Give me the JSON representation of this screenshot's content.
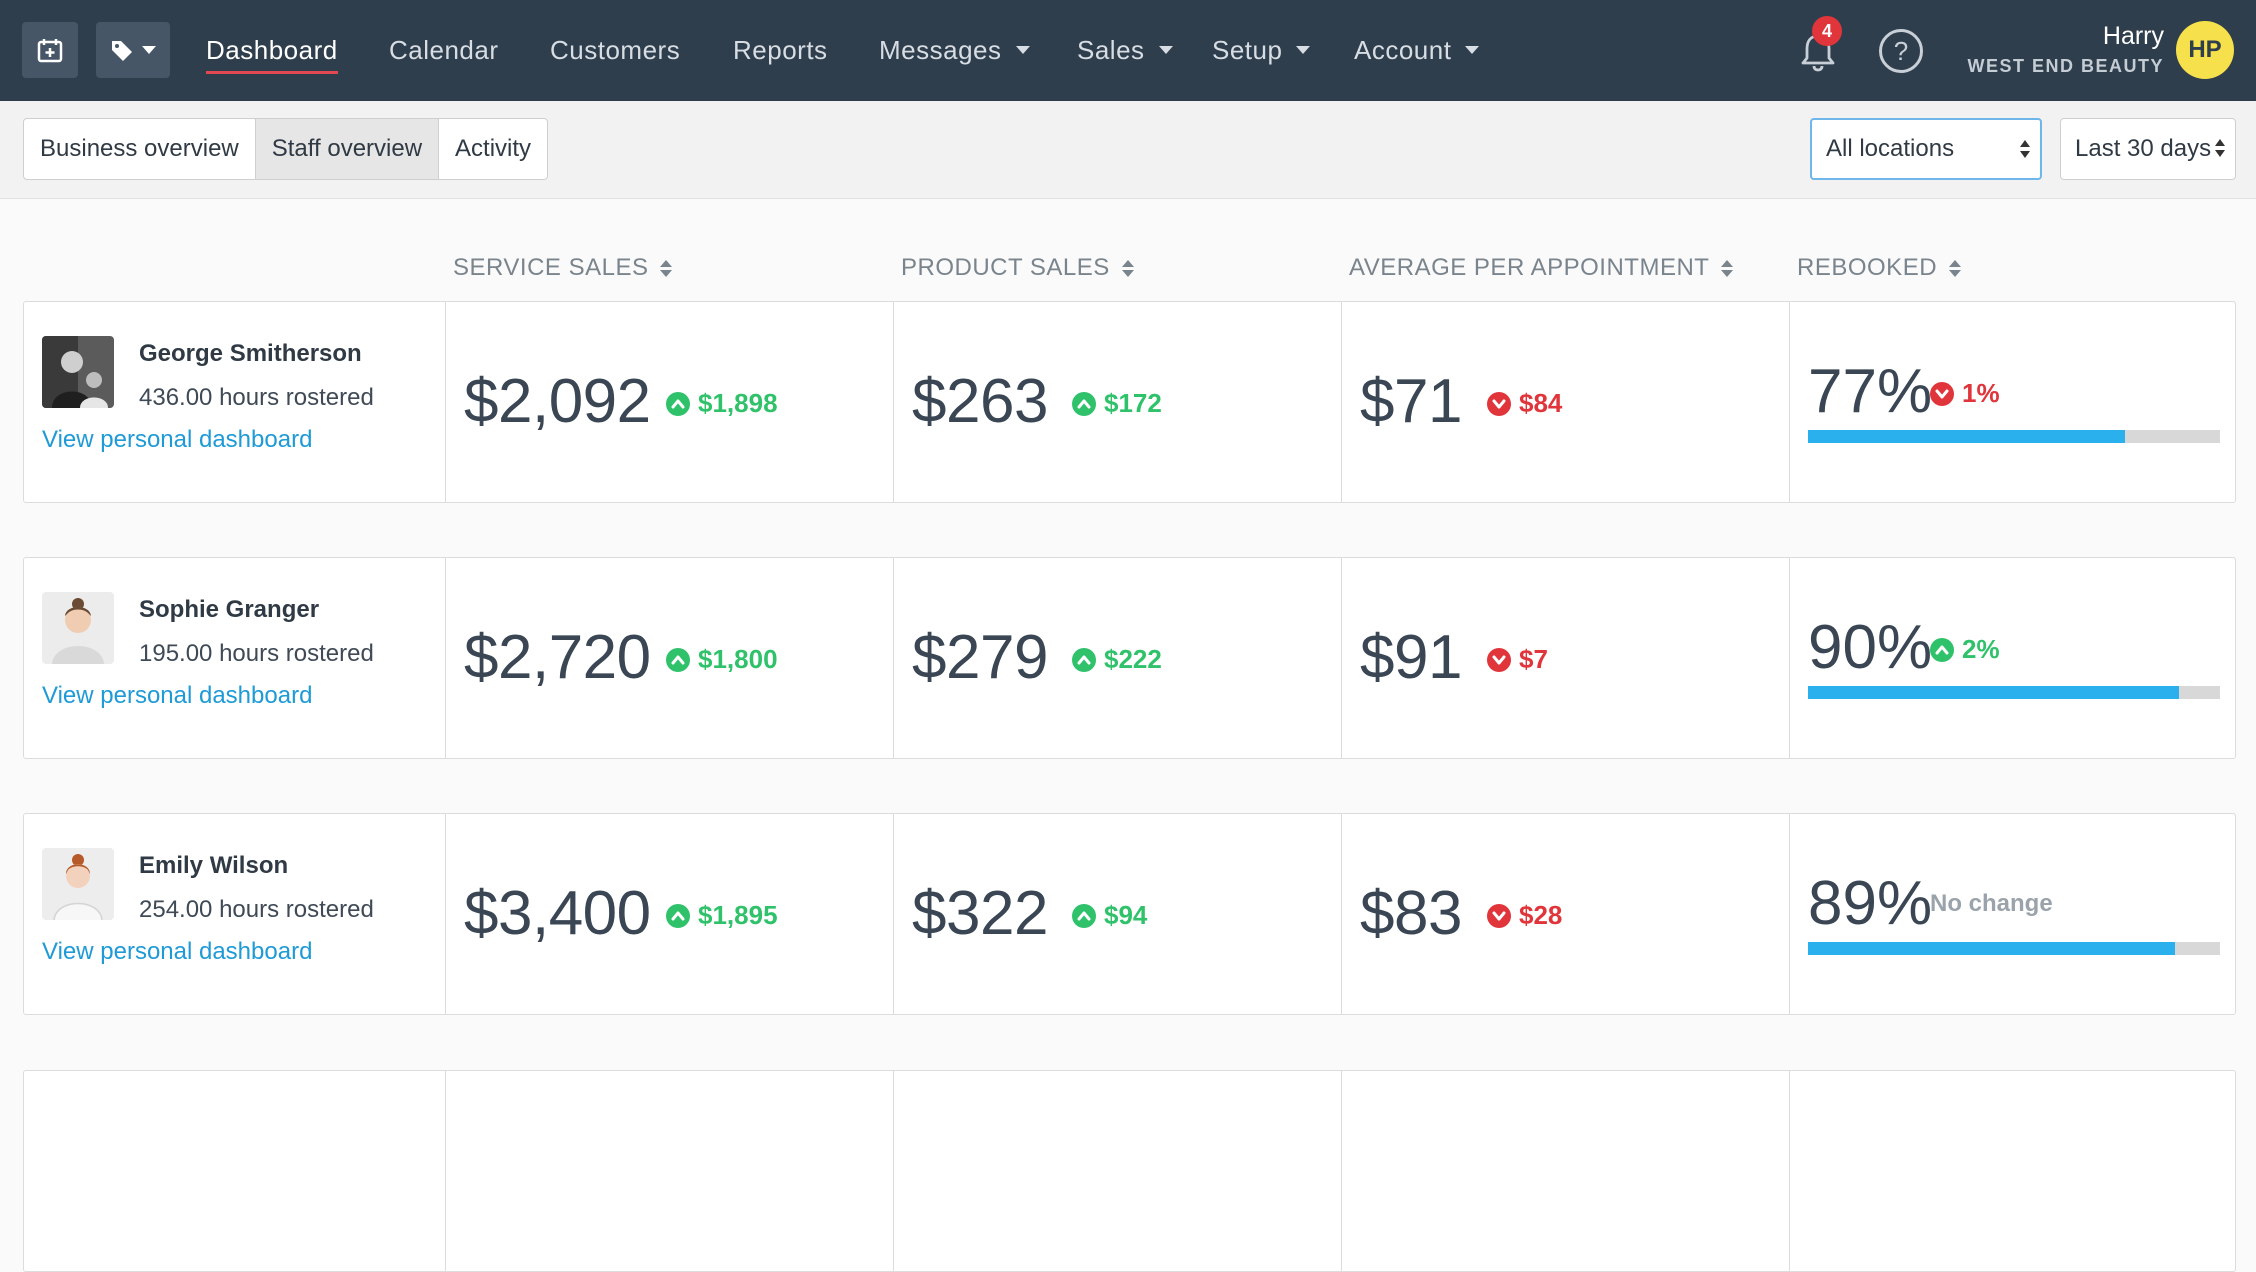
{
  "nav": {
    "links": [
      {
        "label": "Dashboard",
        "active": true
      },
      {
        "label": "Calendar"
      },
      {
        "label": "Customers"
      },
      {
        "label": "Reports"
      },
      {
        "label": "Messages",
        "dropdown": true
      },
      {
        "label": "Sales",
        "dropdown": true
      },
      {
        "label": "Setup",
        "dropdown": true
      },
      {
        "label": "Account",
        "dropdown": true
      }
    ],
    "notification_count": "4",
    "help_glyph": "?",
    "user_name": "Harry",
    "business_name": "WEST END BEAUTY",
    "user_initials": "HP"
  },
  "subnav": {
    "tabs": [
      "Business overview",
      "Staff overview",
      "Activity"
    ],
    "selected_tab": "Staff overview",
    "location_select": "All locations",
    "range_select": "Last 30 days"
  },
  "columns": [
    "SERVICE SALES",
    "PRODUCT SALES",
    "AVERAGE PER APPOINTMENT",
    "REBOOKED"
  ],
  "staff": [
    {
      "name": "George Smitherson",
      "hours": "436.00 hours rostered",
      "link": "View personal dashboard",
      "service_sales": "$2,092",
      "service_delta": "$1,898",
      "service_dir": "up",
      "product_sales": "$263",
      "product_delta": "$172",
      "product_dir": "up",
      "avg": "$71",
      "avg_delta": "$84",
      "avg_dir": "down",
      "rebooked": "77%",
      "rebooked_delta": "1%",
      "rebooked_dir": "down",
      "rebooked_value": 77
    },
    {
      "name": "Sophie Granger",
      "hours": "195.00 hours rostered",
      "link": "View personal dashboard",
      "service_sales": "$2,720",
      "service_delta": "$1,800",
      "service_dir": "up",
      "product_sales": "$279",
      "product_delta": "$222",
      "product_dir": "up",
      "avg": "$91",
      "avg_delta": "$7",
      "avg_dir": "down",
      "rebooked": "90%",
      "rebooked_delta": "2%",
      "rebooked_dir": "up",
      "rebooked_value": 90
    },
    {
      "name": "Emily Wilson",
      "hours": "254.00 hours rostered",
      "link": "View personal dashboard",
      "service_sales": "$3,400",
      "service_delta": "$1,895",
      "service_dir": "up",
      "product_sales": "$322",
      "product_delta": "$94",
      "product_dir": "up",
      "avg": "$83",
      "avg_delta": "$28",
      "avg_dir": "down",
      "rebooked": "89%",
      "rebooked_delta": "No change",
      "rebooked_dir": "none",
      "rebooked_value": 89
    }
  ],
  "colors": {
    "nav_bg": "#2f3e4d",
    "up": "#2fc26a",
    "down": "#e0353b",
    "bar": "#2ab0ec",
    "link": "#1e9ad6",
    "avatar": "#f6e04b"
  }
}
